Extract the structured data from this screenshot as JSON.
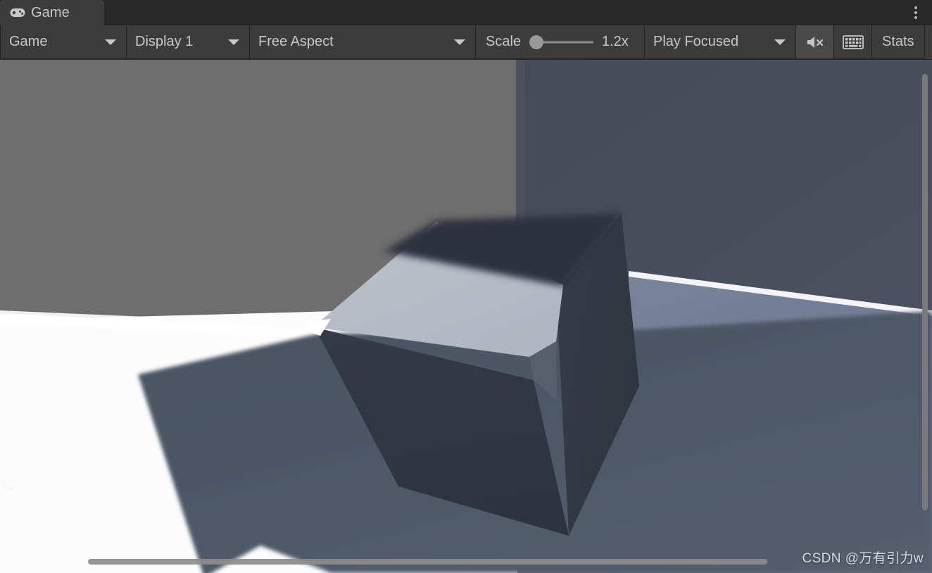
{
  "window": {
    "tab_label": "Game",
    "tab_icon": "gamepad-icon",
    "menu_icon": "kebab-menu-icon"
  },
  "toolbar": {
    "view_select": {
      "value": "Game",
      "icon": "chevron-down-icon"
    },
    "display_select": {
      "value": "Display 1",
      "icon": "chevron-down-icon"
    },
    "aspect_select": {
      "value": "Free Aspect",
      "icon": "chevron-down-icon"
    },
    "scale": {
      "label": "Scale",
      "value": "1.2x",
      "percent": 8
    },
    "play_mode_select": {
      "value": "Play Focused",
      "icon": "chevron-down-icon"
    },
    "mute_audio": {
      "icon": "mute-audio-icon",
      "active": true
    },
    "gizmos": {
      "icon": "gizmos-grid-icon",
      "active": false
    },
    "stats": {
      "label": "Stats"
    }
  },
  "viewport": {
    "scrollbars": {
      "vertical": "vertical-scrollbar",
      "horizontal": "horizontal-scrollbar"
    },
    "watermark": "CSDN @万有引力w",
    "colors": {
      "background_gray": "#6e6e6e",
      "wall_blue": "#454c58",
      "floor_blue": "#707c90",
      "floor_white": "#fdfdfd",
      "shadow_blue": "#4d5665",
      "cube_top_light": "#b9bfc9",
      "cube_top_shadow": "#2e3440",
      "cube_left_dark": "#2f3541",
      "cube_right_dark": "#343a47",
      "cube_bevel": "#585f6c"
    }
  }
}
